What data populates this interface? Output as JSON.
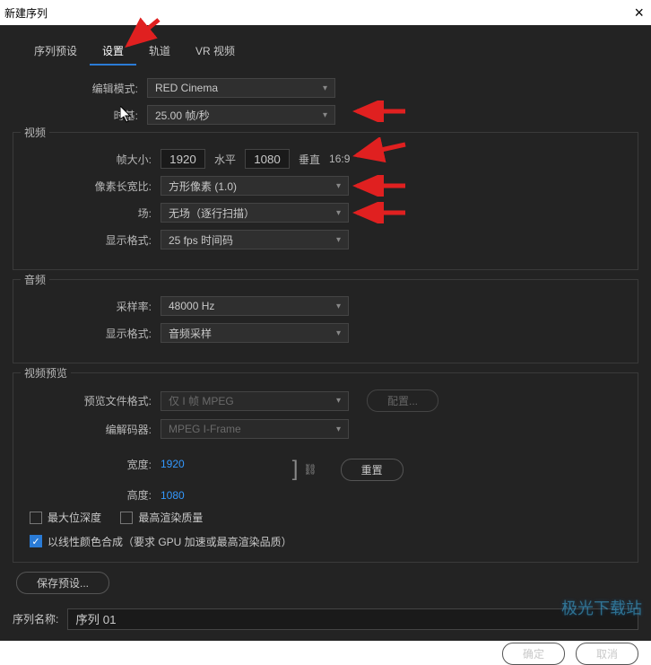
{
  "titlebar": {
    "title": "新建序列"
  },
  "tabs": {
    "preset": "序列预设",
    "settings": "设置",
    "tracks": "轨道",
    "vr": "VR 视频"
  },
  "editing": {
    "edit_mode_label": "编辑模式:",
    "edit_mode_value": "RED Cinema",
    "timebase_label": "时基:",
    "timebase_value": "25.00 帧/秒"
  },
  "video": {
    "group_title": "视频",
    "frame_size_label": "帧大小:",
    "width": "1920",
    "horiz": "水平",
    "height": "1080",
    "vert": "垂直",
    "aspect": "16:9",
    "pixel_aspect_label": "像素长宽比:",
    "pixel_aspect_value": "方形像素 (1.0)",
    "fields_label": "场:",
    "fields_value": "无场（逐行扫描）",
    "display_format_label": "显示格式:",
    "display_format_value": "25 fps 时间码"
  },
  "audio": {
    "group_title": "音频",
    "sample_rate_label": "采样率:",
    "sample_rate_value": "48000 Hz",
    "display_format_label": "显示格式:",
    "display_format_value": "音频采样"
  },
  "preview": {
    "group_title": "视频预览",
    "file_format_label": "预览文件格式:",
    "file_format_value": "仅 I 帧 MPEG",
    "configure_label": "配置...",
    "codec_label": "编解码器:",
    "codec_value": "MPEG I-Frame",
    "width_label": "宽度:",
    "width_value": "1920",
    "height_label": "高度:",
    "height_value": "1080",
    "reset_label": "重置"
  },
  "checks": {
    "max_bit_depth": "最大位深度",
    "max_render_quality": "最高渲染质量",
    "linear_color": "以线性颜色合成（要求 GPU 加速或最高渲染品质）"
  },
  "save_preset": "保存预设...",
  "sequence": {
    "name_label": "序列名称:",
    "name_value": "序列 01"
  },
  "footer": {
    "ok": "确定",
    "cancel": "取消"
  },
  "watermark": "极光下载站"
}
